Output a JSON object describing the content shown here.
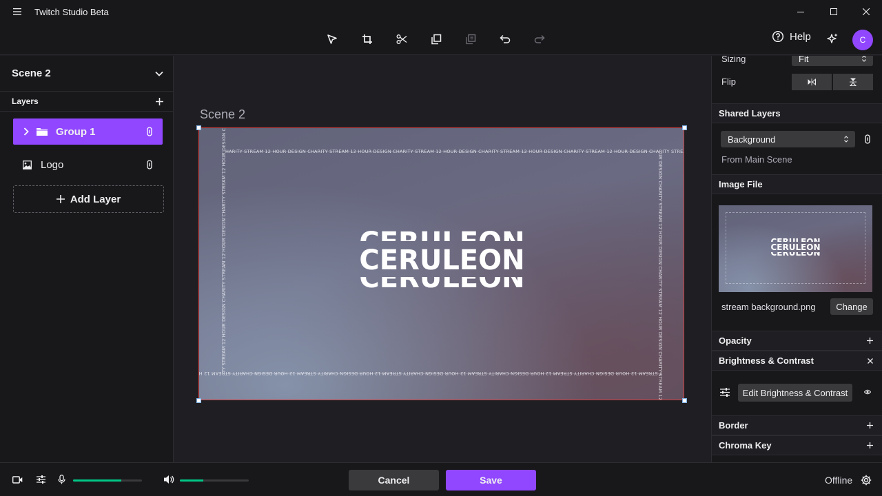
{
  "app": {
    "title": "Twitch Studio Beta",
    "avatar_letter": "C"
  },
  "toolbar": {
    "help_label": "Help"
  },
  "scene": {
    "name": "Scene 2",
    "preview_label": "Scene 2"
  },
  "layers": {
    "header": "Layers",
    "items": [
      {
        "label": "Group 1",
        "icon": "folder-icon",
        "active": true
      },
      {
        "label": "Logo",
        "icon": "image-icon",
        "active": false
      }
    ],
    "add_label": "Add Layer"
  },
  "preview": {
    "logo_text": "CERULEON",
    "ring_text_top": "HARITY STREAM 12 HOUR DESIGN CHARITY STREAM 12 HOUR DESIGN CHARITY STREAM 12 HOUR DESIGN CHARITY STREAM 12 HOUR DESIGN CHARITY STREAM 12 HOUR DESIGN CHARITY STREAM 12 HOUR DESIGN C",
    "ring_text_bottom": "Y STREAM 12 HOUR DESIGN CHARITY STREAM 12 HOUR DESIGN CHARITY STREAM 12 HOUR DESIGN CHARITY STREAM 12 HOUR DESIGN CHARITY STREAM 12 HOUR DESIGN CHARITY STREAM 12 HOUR DESIGN CHAR",
    "ring_text_left": "TY STREAM 12 HOUR DESIGN CHARITY STREAM 12 HOUR DESIGN CHARITY STREAM 12 HOUR DESIGN C",
    "ring_text_right": "UR DESIGN CHARITY STREAM 12 HOUR DESIGN CHARITY STREAM 12 HOUR DESIGN CHARITY STREAM 12"
  },
  "properties": {
    "sizing_label": "Sizing",
    "sizing_value": "Fit",
    "flip_label": "Flip",
    "shared_layers": {
      "header": "Shared Layers",
      "value": "Background",
      "source": "From Main Scene"
    },
    "image_file": {
      "header": "Image File",
      "filename": "stream background.png",
      "change_label": "Change"
    },
    "opacity": "Opacity",
    "brightness_contrast": {
      "header": "Brightness & Contrast",
      "edit_label": "Edit Brightness & Contrast"
    },
    "border": "Border",
    "chroma_key": "Chroma Key"
  },
  "footer": {
    "cancel_label": "Cancel",
    "save_label": "Save",
    "status": "Offline",
    "mic_level": 0.7,
    "desktop_level": 0.34
  },
  "colors": {
    "accent": "#9147ff",
    "meter": "#00c785",
    "selection": "#d23c3c"
  }
}
